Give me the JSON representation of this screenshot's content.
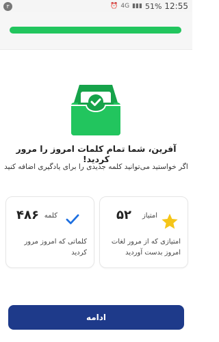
{
  "status_bar": {
    "notification_count": "۳",
    "network": "4G",
    "battery": "51%",
    "time": "12:55"
  },
  "progress": {
    "fraction": 1.0,
    "color": "#22c55e"
  },
  "illustration": {
    "icon": "inbox-check-icon",
    "color": "#22c55e"
  },
  "message": {
    "title": "آفرین، شما تمام کلمات امروز را مرور کردید!",
    "subtitle": "اگر خواستید می‌توانید کلمه جدیدی را برای یادگیری اضافه کنید"
  },
  "cards": {
    "score": {
      "value": "۵۲",
      "label": "امتیاز",
      "description": "امتیازی که از مرور لغات امروز بدست آوردید",
      "icon": "star-icon",
      "icon_color": "#f5c518"
    },
    "words": {
      "value": "۴۸۶",
      "label": "کلمه",
      "description": "کلماتی که امروز مرور کردید",
      "icon": "check-icon",
      "icon_color": "#1d6fe0"
    }
  },
  "continue_button": {
    "label": "ادامه",
    "color": "#1e3a8a"
  }
}
